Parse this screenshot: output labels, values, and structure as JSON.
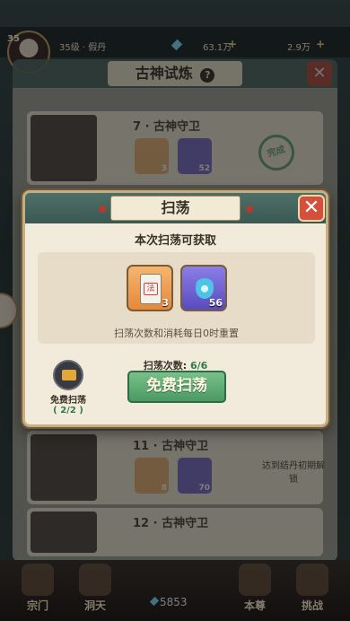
{
  "status_bar": {
    "level_number": "35",
    "level_text": "35级 · 假丹",
    "spirit_stones": "63.1万",
    "coins": "2.9万",
    "add_symbol": "+"
  },
  "background_panel": {
    "title": "古神试炼",
    "help_symbol": "?",
    "close_symbol": "✕",
    "stages": [
      {
        "name": "7 · 古神守卫",
        "item1_count": "3",
        "item2_count": "52",
        "status": "完成"
      },
      {
        "name": "11 · 古神守卫",
        "item1_count": "8",
        "item2_count": "70",
        "status": "达到结丹初期解锁"
      },
      {
        "name": "12 · 古神守卫"
      }
    ]
  },
  "sweep_dialog": {
    "title": "扫荡",
    "close_symbol": "✕",
    "subtitle": "本次扫荡可获取",
    "rewards": [
      {
        "icon": "talisman-paper-icon",
        "symbol": "法",
        "count": "3"
      },
      {
        "icon": "blue-spirit-flame-icon",
        "count": "56"
      }
    ],
    "reset_note": "扫荡次数和消耗每日0时重置",
    "sweep_count_label": "扫荡次数:",
    "sweep_count_value": "6/6",
    "free_button": "免费扫荡",
    "free_sweep_badge_label": "免费扫荡",
    "free_sweep_badge_count": "( 2/2 )"
  },
  "bottom_nav": {
    "items": [
      {
        "label": "宗门"
      },
      {
        "label": "洞天"
      },
      {
        "label": "本尊"
      },
      {
        "label": "挑战"
      }
    ],
    "center_value": "5853"
  },
  "colors": {
    "dialog_header": "#4e6f69",
    "button_green": "#4a9a62",
    "close_red": "#d4503c",
    "accent_text_green": "#2f7a4a"
  }
}
